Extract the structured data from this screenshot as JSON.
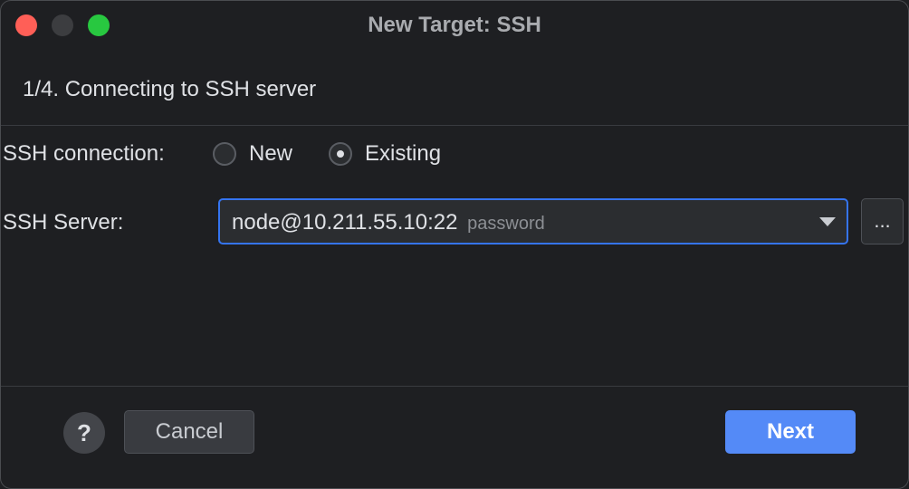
{
  "window": {
    "title": "New Target: SSH"
  },
  "step": {
    "title": "1/4. Connecting to SSH server"
  },
  "connection": {
    "label": "SSH connection:",
    "options": [
      {
        "label": "New",
        "selected": false
      },
      {
        "label": "Existing",
        "selected": true
      }
    ]
  },
  "server": {
    "label": "SSH Server:",
    "value": "node@10.211.55.10:22",
    "auth": "password",
    "browse_label": "..."
  },
  "footer": {
    "help_label": "?",
    "cancel_label": "Cancel",
    "next_label": "Next"
  },
  "colors": {
    "background": "#1e1f22",
    "accent": "#548af7",
    "focus_border": "#3574f0",
    "close": "#ff5f57",
    "maximize": "#28c840"
  },
  "icons": {
    "dropdown": "chevron-down-icon",
    "help": "help-icon"
  }
}
